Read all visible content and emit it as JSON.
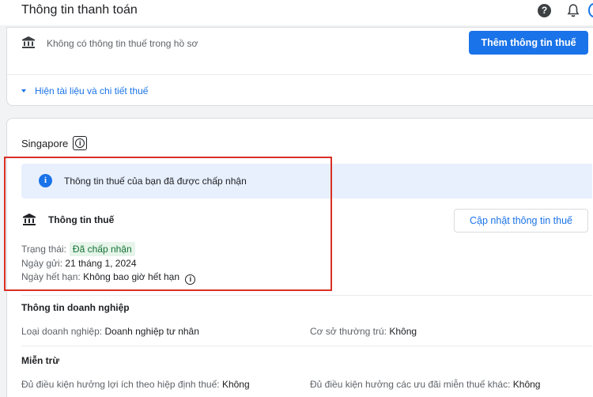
{
  "header": {
    "title": "Thông tin thanh toán",
    "help_glyph": "?"
  },
  "tax_card": {
    "no_tax_info": "Không có thông tin thuế trong hồ sơ",
    "add_button": "Thêm thông tin thuế",
    "expand_link": "Hiện tài liệu và chi tiết thuế"
  },
  "country_card": {
    "country": "Singapore",
    "info_glyph": "i",
    "banner_text": "Thông tin thuế của bạn đã được chấp nhận",
    "tax_info_title": "Thông tin thuế",
    "update_button": "Cập nhật thông tin thuế",
    "status_label": "Trạng thái:",
    "status_value": "Đã chấp nhận",
    "submitted_label": "Ngày gửi:",
    "submitted_value": "21 tháng 1, 2024",
    "expiry_label": "Ngày hết hạn:",
    "expiry_value": "Không bao giờ hết hạn"
  },
  "business": {
    "title": "Thông tin doanh nghiệp",
    "type_label": "Loại doanh nghiệp:",
    "type_value": "Doanh nghiệp tư nhân",
    "residence_label": "Cơ sở thường trú:",
    "residence_value": "Không"
  },
  "exemption": {
    "title": "Miễn trừ",
    "treaty_label": "Đủ điều kiện hưởng lợi ích theo hiệp định thuế:",
    "treaty_value": "Không",
    "other_label": "Đủ điều kiện hưởng các ưu đãi miễn thuế khác:",
    "other_value": "Không"
  },
  "colors": {
    "primary": "#1a73e8",
    "highlight": "#d93025",
    "success_bg": "#e6f4ea",
    "success_text": "#137333"
  },
  "icons": [
    "help-icon",
    "bell-icon",
    "bank-icon",
    "info-icon",
    "caret-down-icon"
  ]
}
